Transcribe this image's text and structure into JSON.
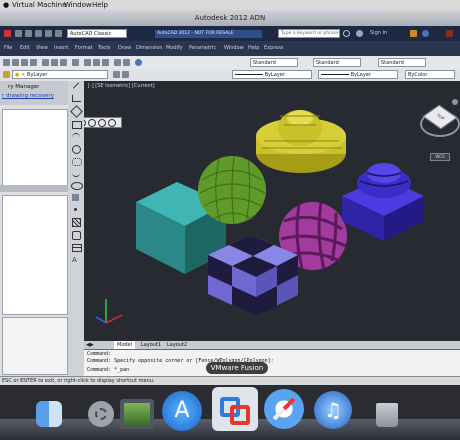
{
  "mac_menu": {
    "items": [
      "Window",
      "Help"
    ],
    "vm_item": "Virtual Machine"
  },
  "window": {
    "title": "Autodesk 2012 ADN"
  },
  "ribbon": {
    "workspace": "AutoCAD Classic",
    "badge": "AutoCAD 2012 - NOT FOR RESALE",
    "search_placeholder": "Type a keyword or phrase",
    "sign_in": "Sign In",
    "menus": [
      "File",
      "Edit",
      "View",
      "Insert",
      "Format",
      "Tools",
      "Draw",
      "Dimension",
      "Modify",
      "Parametric",
      "Window",
      "Help",
      "Express"
    ]
  },
  "toolbar": {
    "style1": "Standard",
    "style2": "Standard",
    "style3": "Standard",
    "layer_dropdown": "ByLayer",
    "linetype": "ByLayer",
    "lineweight": "ByLayer",
    "color": "ByColor"
  },
  "left_panel": {
    "title": "ry Manager",
    "link": "r drawing recovery"
  },
  "viewport": {
    "label": "[-] [SE Isometric] [Current]",
    "wcs": "WCS",
    "cube_face": "TOP"
  },
  "tabs": [
    "Model",
    "Layout1",
    "Layout2"
  ],
  "command": {
    "line1": "Command:",
    "line2": "Command: Specify opposite corner or [Fence/WPolygon/CPolygon]:",
    "line3": "Command: *_pan"
  },
  "status": {
    "text": "ESC or ENTER to exit, or right-click to display shortcut menu."
  },
  "dock": {
    "tooltip": "VMware Fusion"
  },
  "colors": {
    "viewport_bg": "#282a31",
    "cube": "#2f8a88",
    "sphere_green": "#5f9a2a",
    "dome_yellow": "#c8c12a",
    "sphere_magenta": "#a33a9e",
    "blue_shape": "#3b2ec8",
    "checker_light": "#8a86e6",
    "checker_dark": "#1f1b3e"
  }
}
